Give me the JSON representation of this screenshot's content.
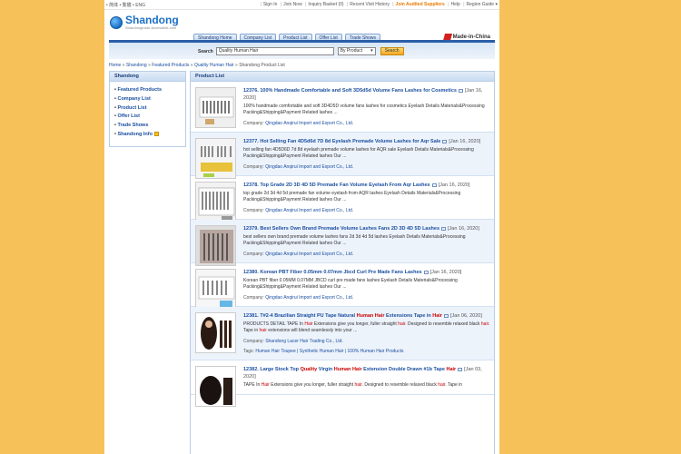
{
  "topbar": {
    "lang": "• 简体 • 繁體 • ENG",
    "links": [
      "Sign In",
      "Join Now",
      "Inquiry Basket (0)",
      "Recent Visit History",
      "Join Audited Suppliers",
      "Help",
      "Region Guide ▾"
    ]
  },
  "header": {
    "logo_text": "Shandong",
    "logo_sub": "Shandongtrade.Accessible.com",
    "nav": [
      "Shandong Home",
      "Company List",
      "Product List",
      "Offer List",
      "Trade Shows"
    ],
    "mic": "Made-in-China"
  },
  "search": {
    "label": "Search",
    "value": "Quality Human Hair",
    "select": "By Product",
    "button": "Search"
  },
  "breadcrumb": [
    "Home",
    "Shandong",
    "Featured Products",
    "Quality Human Hair",
    "Shandong Product List"
  ],
  "sidebar": {
    "title": "Shandong",
    "items": [
      "Featured Products",
      "Company List",
      "Product List",
      "Offer List",
      "Trade Shows",
      "Shandong Info"
    ]
  },
  "products": {
    "title": "Product List",
    "company_label": "Company:",
    "tags_label": "Tags:",
    "items": [
      {
        "no": "12376.",
        "title": "100% Handmade Comfortable and Soft 3D5d5d Volume Fans Lashes for Cosmetics",
        "date": "[Jan 16, 2020]",
        "desc": "100% handmade comfortable and soft 3D4D5D volume fans lashes for cosmetics Eyelash Details Materials&Processing Packing&Shipping&Payment Related lashes ...",
        "company": "Qingdao Anqirui Import and Export Co., Ltd."
      },
      {
        "no": "12377.",
        "title": "Hot Selling Fan 4D5d6d 7D 8d Eyelash Premade Volume Lashes for Aqr Sale",
        "date": "[Jan 16, 2020]",
        "desc": "hot selling fan 4D5D6D 7d 8d eyelash premade volume lashes for AQR sale Eyelash Details Materials&Processing Packing&Shipping&Payment Related lashes Our ...",
        "company": "Qingdao Anqirui Import and Export Co., Ltd."
      },
      {
        "no": "12378.",
        "title": "Top Grade 2D 3D 4D 5D Premade Fan Volume Eyelash From Aqr Lashes",
        "date": "[Jan 16, 2020]",
        "desc": "top grade 2d 3d 4d 5d premade fan volume eyelash from AQR lashes Eyelash Details Materials&Processing Packing&Shipping&Payment Related lashes Our ...",
        "company": "Qingdao Anqirui Import and Export Co., Ltd."
      },
      {
        "no": "12379.",
        "title": "Best Sellers Own Brand Premade Volume Lashes Fans 2D 3D 4D 5D Lashes",
        "date": "[Jan 16, 2020]",
        "desc": "best sellers own brand premade volume lashes fans 2d 3d 4d 5d lashes Eyelash Details Materials&Processing Packing&Shipping&Payment Related lashes Our ...",
        "company": "Qingdao Anqirui Import and Export Co., Ltd."
      },
      {
        "no": "12380.",
        "title": "Korean PBT Fiber 0.05mm 0.07mm Jbcd Curl Pre Made Fans Lashes",
        "date": "[Jan 16, 2020]",
        "desc": "Korean PBT fiber 0.05MM 0.07MM JBCD curl pre made fans lashes Eyelash Details Materials&Processing Packing&Shipping&Payment Related lashes Our ...",
        "company": "Qingdao Anqirui Import and Export Co., Ltd."
      },
      {
        "no": "12381.",
        "title_a": "T#2-4 Brazilian Straight PU Tape Natural ",
        "title_red": "Human Hair",
        "title_b": " Extensions Tape in ",
        "title_red2": "Hair",
        "date": "[Jan 06, 2020]",
        "desc_a": "PRODUCTS DETAIL TAPE In ",
        "desc_r1": "Hair",
        "desc_b": " Extensions give you longer, fuller straight ",
        "desc_r2": "hair",
        "desc_c": ". Designed to resemble relaxed black ",
        "desc_r3": "hair",
        "desc_d": ". Tape in ",
        "desc_r4": "hair",
        "desc_e": " extensions will blend seamlessly into your ...",
        "company": "Shandong Lacer Hair Trading Co., Ltd.",
        "tags": "Human Hair Toupee | Synthetic Human Hair | 100% Human Hair Products"
      },
      {
        "no": "12382.",
        "title_a": "Large Stock Top ",
        "title_red": "Quality",
        "title_b": " Virgin ",
        "title_red2": "Human Hair",
        "title_c": " Extension Double Drawn #1b Tape ",
        "title_red3": "Hair",
        "date": "[Jan 03, 2020]",
        "desc_a": "TAPE In ",
        "desc_r1": "Hair",
        "desc_b": " Extensions give you longer, fuller straight ",
        "desc_r2": "hair",
        "desc_c": ". Designed to resemble relaxed black ",
        "desc_r3": "hair",
        "desc_d": ". Tape in"
      }
    ]
  },
  "colors": {
    "background": "#f7c15a",
    "link": "#1a4fa0",
    "highlight": "#cc0000"
  }
}
